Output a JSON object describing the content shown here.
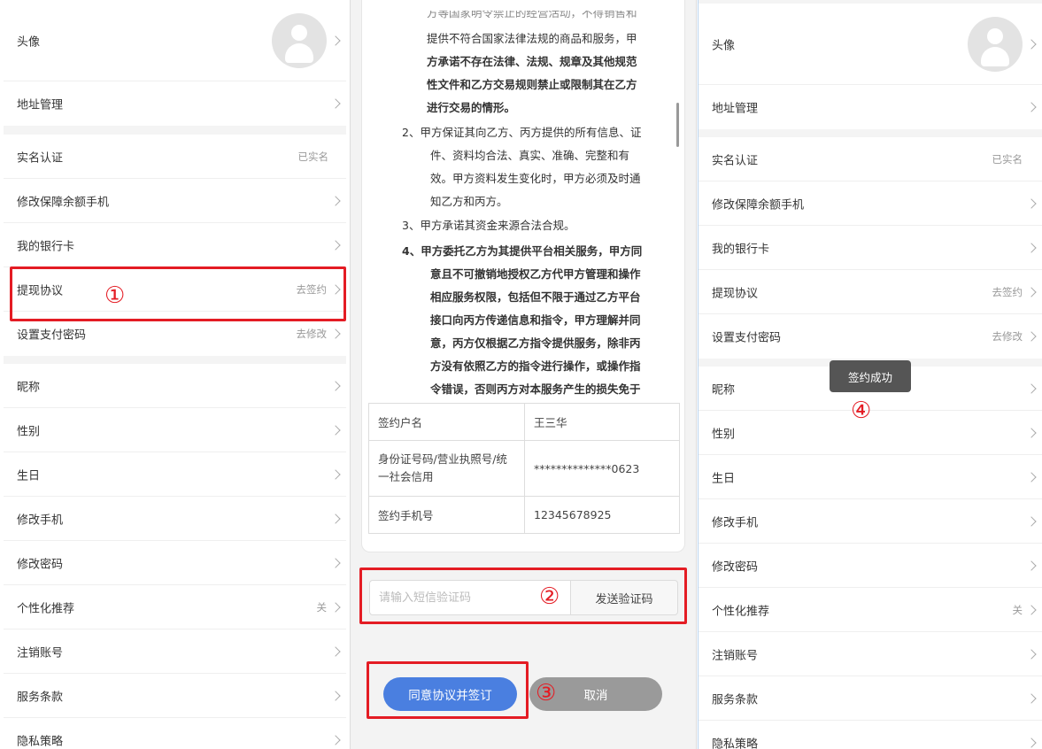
{
  "profile_settings": {
    "groups": [
      [
        {
          "label": "头像",
          "avatar": true
        },
        {
          "label": "地址管理",
          "value": ""
        }
      ],
      [
        {
          "label": "实名认证",
          "value": "已实名",
          "chevron": false
        },
        {
          "label": "修改保障余额手机",
          "value": ""
        },
        {
          "label": "我的银行卡",
          "value": ""
        },
        {
          "label": "提现协议",
          "value": "去签约"
        },
        {
          "label": "设置支付密码",
          "value": "去修改"
        }
      ],
      [
        {
          "label": "昵称",
          "value": ""
        },
        {
          "label": "性别",
          "value": ""
        },
        {
          "label": "生日",
          "value": ""
        },
        {
          "label": "修改手机",
          "value": ""
        },
        {
          "label": "修改密码",
          "value": ""
        },
        {
          "label": "个性化推荐",
          "value": "关"
        },
        {
          "label": "注销账号",
          "value": ""
        },
        {
          "label": "服务条款",
          "value": ""
        },
        {
          "label": "隐私策略",
          "value": ""
        }
      ]
    ]
  },
  "right_settings": {
    "rows": [
      "头像",
      "地址管理",
      "实名认证",
      "修改保障余额手机",
      "我的银行卡",
      "提现协议",
      "设置支付密码",
      "昵称",
      "性别",
      "生日",
      "修改手机",
      "修改密码",
      "个性化推荐",
      "注销账号",
      "服务条款",
      "隐私策略"
    ],
    "values": {
      "实名认证": "已实名",
      "提现协议": "去签约",
      "设置支付密码": "去修改",
      "个性化推荐": "关"
    }
  },
  "agreement": {
    "clause_1_tail_lines": [
      "提供不符合国家法律法规的商品和服务，甲",
      "方承诺不存在法律、法规、规章及其他规范",
      "性文件和乙方交易规则禁止或限制其在乙方",
      "进行交易的情形。"
    ],
    "clause_2_lines": [
      "2、甲方保证其向乙方、丙方提供的所有信息、证",
      "件、资料均合法、真实、准确、完整和有",
      "效。甲方资料发生变化时，甲方必须及时通",
      "知乙方和丙方。"
    ],
    "clause_3": "3、甲方承诺其资金来源合法合规。",
    "clause_4_lines": [
      "4、甲方委托乙方为其提供平台相关服务，甲方同",
      "意且不可撤销地授权乙方代甲方管理和操作",
      "相应服务权限，包括但不限于通过乙方平台",
      "接口向丙方传递信息和指令，甲方理解并同",
      "意，丙方仅根据乙方指令提供服务，除非丙",
      "方没有依照乙方的指令进行操作，或操作指",
      "令错误，否则丙方对本服务产生的损失免于"
    ],
    "table": [
      {
        "label": "签约户名",
        "value": "王三华"
      },
      {
        "label": "身份证号码/营业执照号/统一社会信用",
        "value": "**************0623"
      },
      {
        "label": "签约手机号",
        "value": "12345678925"
      }
    ],
    "sms_placeholder": "请输入短信验证码",
    "send_code_label": "发送验证码",
    "agree_label": "同意协议并签订",
    "cancel_label": "取消"
  },
  "toast": {
    "text": "签约成功"
  },
  "step_markers": [
    "①",
    "②",
    "③",
    "④"
  ],
  "colors": {
    "highlight": "#e41c24",
    "primary": "#4a7fe0",
    "cancel": "#9a9a9a",
    "toast": "#555555"
  }
}
